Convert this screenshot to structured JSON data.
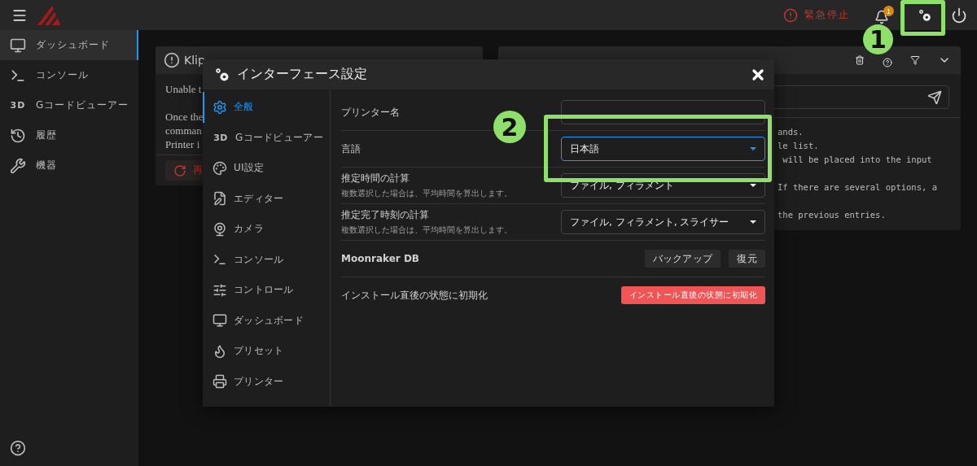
{
  "topbar": {
    "emergency_stop": "緊急停止",
    "notification_count": "1"
  },
  "sidebar": {
    "items": [
      {
        "label": "ダッシュボード",
        "selected": true
      },
      {
        "label": "コンソール",
        "selected": false
      },
      {
        "label": "Gコードビューアー",
        "icon_text": "3D",
        "selected": false
      },
      {
        "label": "履歴",
        "selected": false
      },
      {
        "label": "機器",
        "selected": false
      }
    ]
  },
  "klippy_card": {
    "title": "Klip",
    "paragraphs": [
      [
        "Unable t"
      ],
      [
        "Once the",
        "comman",
        "Printer i"
      ]
    ],
    "restart_button": "再"
  },
  "console_card": {
    "paragraphs": [
      [
        "ands.",
        "le list.",
        " will be placed into the input"
      ],
      [
        "If there are several options, a"
      ],
      [
        "the previous entries."
      ]
    ]
  },
  "dialog": {
    "title": "インターフェース設定",
    "nav": [
      {
        "label": "全般",
        "selected": true
      },
      {
        "label": "Gコードビューアー",
        "icon_text": "3D",
        "selected": false
      },
      {
        "label": "UI設定",
        "selected": false
      },
      {
        "label": "エディター",
        "selected": false
      },
      {
        "label": "カメラ",
        "selected": false
      },
      {
        "label": "コンソール",
        "selected": false
      },
      {
        "label": "コントロール",
        "selected": false
      },
      {
        "label": "ダッシュボード",
        "selected": false
      },
      {
        "label": "プリセット",
        "selected": false
      },
      {
        "label": "プリンター",
        "selected": false
      }
    ],
    "settings": [
      {
        "kind": "text",
        "label": "プリンター名"
      },
      {
        "kind": "select",
        "label": "言語",
        "value": "日本語",
        "focused": true
      },
      {
        "kind": "select",
        "label": "推定時間の計算",
        "hint": "複数選択した場合は、平均時間を算出します。",
        "value": "ファイル, フィラメント",
        "focused": false
      },
      {
        "kind": "select",
        "label": "推定完了時刻の計算",
        "hint": "複数選択した場合は、平均時間を算出します。",
        "value": "ファイル, フィラメント, スライサー",
        "focused": false
      },
      {
        "kind": "buttons",
        "label": "Moonraker DB",
        "buttons": [
          "バックアップ",
          "復元"
        ]
      },
      {
        "kind": "danger",
        "label": "インストール直後の状態に初期化",
        "button": "インストール直後の状態に初期化"
      }
    ]
  },
  "annotations": [
    {
      "label": "1"
    },
    {
      "label": "2"
    }
  ]
}
